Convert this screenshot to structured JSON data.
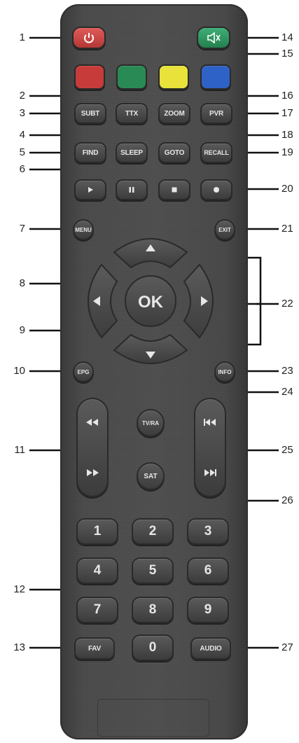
{
  "colors": {
    "power": "#cc4646",
    "mute": "#2f9a63",
    "red": "#c73c3a",
    "green": "#2a8a55",
    "yellow": "#e8e23a",
    "blue": "#2f62c6"
  },
  "icons": {
    "power": "power-icon",
    "mute": "mute-icon",
    "play": "play-icon",
    "pause": "pause-icon",
    "stop": "stop-icon",
    "record": "record-icon",
    "up": "arrow-up-icon",
    "down": "arrow-down-icon",
    "left": "arrow-left-icon",
    "right": "arrow-right-icon",
    "rewind": "rewind-icon",
    "fast_forward": "fast-forward-icon",
    "prev": "previous-track-icon",
    "next": "next-track-icon"
  },
  "buttons": {
    "subt": "SUBT",
    "ttx": "TTX",
    "zoom": "ZOOM",
    "pvr": "PVR",
    "find": "FIND",
    "sleep": "SLEEP",
    "goto": "GOTO",
    "recall": "RECALL",
    "menu": "MENU",
    "exit": "EXIT",
    "ok": "OK",
    "epg": "EPG",
    "info": "INFO",
    "tvra": "TV/RA",
    "sat": "SAT",
    "fav": "FAV",
    "audio": "AUDIO",
    "digits": [
      "1",
      "2",
      "3",
      "4",
      "5",
      "6",
      "7",
      "8",
      "9"
    ],
    "zero": "0"
  },
  "callouts": [
    "1",
    "2",
    "3",
    "4",
    "5",
    "6",
    "7",
    "8",
    "9",
    "10",
    "11",
    "12",
    "13",
    "14",
    "15",
    "16",
    "17",
    "18",
    "19",
    "20",
    "21",
    "22",
    "23",
    "24",
    "25",
    "26",
    "27"
  ]
}
